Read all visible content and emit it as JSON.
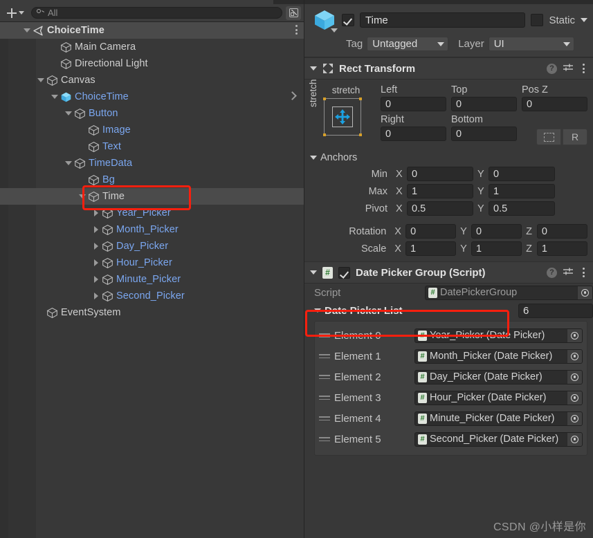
{
  "hierarchy": {
    "toolbar": {
      "add_label": "+",
      "search_placeholder": "All",
      "search_value": "All",
      "search_icon": "search-icon",
      "popout_icon": "popout-icon"
    },
    "rows": [
      {
        "label": "ChoiceTime",
        "indent": 1,
        "foldout": "open",
        "icon": "unity-scene-icon",
        "style": "root",
        "kebab": true
      },
      {
        "label": "Main Camera",
        "indent": 3,
        "foldout": "none",
        "icon": "gameobject-cube-icon",
        "style": "white"
      },
      {
        "label": "Directional Light",
        "indent": 3,
        "foldout": "none",
        "icon": "gameobject-cube-icon",
        "style": "white"
      },
      {
        "label": "Canvas",
        "indent": 2,
        "foldout": "open",
        "icon": "gameobject-cube-icon",
        "style": "white"
      },
      {
        "label": "ChoiceTime",
        "indent": 3,
        "foldout": "open",
        "icon": "prefab-cube-icon",
        "style": "blue",
        "chevron": true
      },
      {
        "label": "Button",
        "indent": 4,
        "foldout": "open",
        "icon": "gameobject-cube-icon",
        "style": "blue"
      },
      {
        "label": "Image",
        "indent": 5,
        "foldout": "none",
        "icon": "gameobject-cube-icon",
        "style": "blue"
      },
      {
        "label": "Text",
        "indent": 5,
        "foldout": "none",
        "icon": "gameobject-cube-icon",
        "style": "blue"
      },
      {
        "label": "TimeData",
        "indent": 4,
        "foldout": "open",
        "icon": "gameobject-cube-icon",
        "style": "blue"
      },
      {
        "label": "Bg",
        "indent": 5,
        "foldout": "none",
        "icon": "gameobject-cube-icon",
        "style": "blue"
      },
      {
        "label": "Time",
        "indent": 5,
        "foldout": "open",
        "icon": "gameobject-cube-icon",
        "style": "selected"
      },
      {
        "label": "Year_Picker",
        "indent": 6,
        "foldout": "closed",
        "icon": "gameobject-cube-icon",
        "style": "blue"
      },
      {
        "label": "Month_Picker",
        "indent": 6,
        "foldout": "closed",
        "icon": "gameobject-cube-icon",
        "style": "blue"
      },
      {
        "label": "Day_Picker",
        "indent": 6,
        "foldout": "closed",
        "icon": "gameobject-cube-icon",
        "style": "blue"
      },
      {
        "label": "Hour_Picker",
        "indent": 6,
        "foldout": "closed",
        "icon": "gameobject-cube-icon",
        "style": "blue"
      },
      {
        "label": "Minute_Picker",
        "indent": 6,
        "foldout": "closed",
        "icon": "gameobject-cube-icon",
        "style": "blue"
      },
      {
        "label": "Second_Picker",
        "indent": 6,
        "foldout": "closed",
        "icon": "gameobject-cube-icon",
        "style": "blue"
      },
      {
        "label": "EventSystem",
        "indent": 2,
        "foldout": "none",
        "icon": "gameobject-cube-icon",
        "style": "white"
      }
    ]
  },
  "inspector": {
    "object_enabled": true,
    "object_name": "Time",
    "static_label": "Static",
    "static_checked": false,
    "tag_label": "Tag",
    "tag_value": "Untagged",
    "layer_label": "Layer",
    "layer_value": "UI",
    "rect_transform": {
      "title": "Rect Transform",
      "anchor_preset_top": "stretch",
      "anchor_preset_side": "stretch",
      "left_label": "Left",
      "left_value": "0",
      "top_label": "Top",
      "top_value": "0",
      "posz_label": "Pos Z",
      "posz_value": "0",
      "right_label": "Right",
      "right_value": "0",
      "bottom_label": "Bottom",
      "bottom_value": "0",
      "blueprint_label": "",
      "raw_label": "R",
      "anchors_label": "Anchors",
      "min_label": "Min",
      "min_x": "0",
      "min_y": "0",
      "max_label": "Max",
      "max_x": "1",
      "max_y": "1",
      "pivot_label": "Pivot",
      "pivot_x": "0.5",
      "pivot_y": "0.5",
      "rotation_label": "Rotation",
      "rot_x": "0",
      "rot_y": "0",
      "rot_z": "0",
      "scale_label": "Scale",
      "scale_x": "1",
      "scale_y": "1",
      "scale_z": "1",
      "axis_x": "X",
      "axis_y": "Y",
      "axis_z": "Z"
    },
    "date_picker_group": {
      "title": "Date Picker Group (Script)",
      "enabled": true,
      "script_label": "Script",
      "script_value": "DatePickerGroup",
      "list_label": "Date Picker List",
      "list_size": "6",
      "elements": [
        {
          "label": "Element 0",
          "value": "Year_Picker (Date Picker)"
        },
        {
          "label": "Element 1",
          "value": "Month_Picker (Date Picker)"
        },
        {
          "label": "Element 2",
          "value": "Day_Picker (Date Picker)"
        },
        {
          "label": "Element 3",
          "value": "Hour_Picker (Date Picker)"
        },
        {
          "label": "Element 4",
          "value": "Minute_Picker (Date Picker)"
        },
        {
          "label": "Element 5",
          "value": "Second_Picker (Date Picker)"
        }
      ]
    }
  },
  "watermark": "CSDN @小样是你",
  "colors": {
    "accent_blue": "#7ba7f0",
    "prefab_cyan": "#4fc3f7",
    "annotation_red": "#f81f0e",
    "panel_bg": "#383838",
    "header_bg": "#3c3c3c"
  }
}
